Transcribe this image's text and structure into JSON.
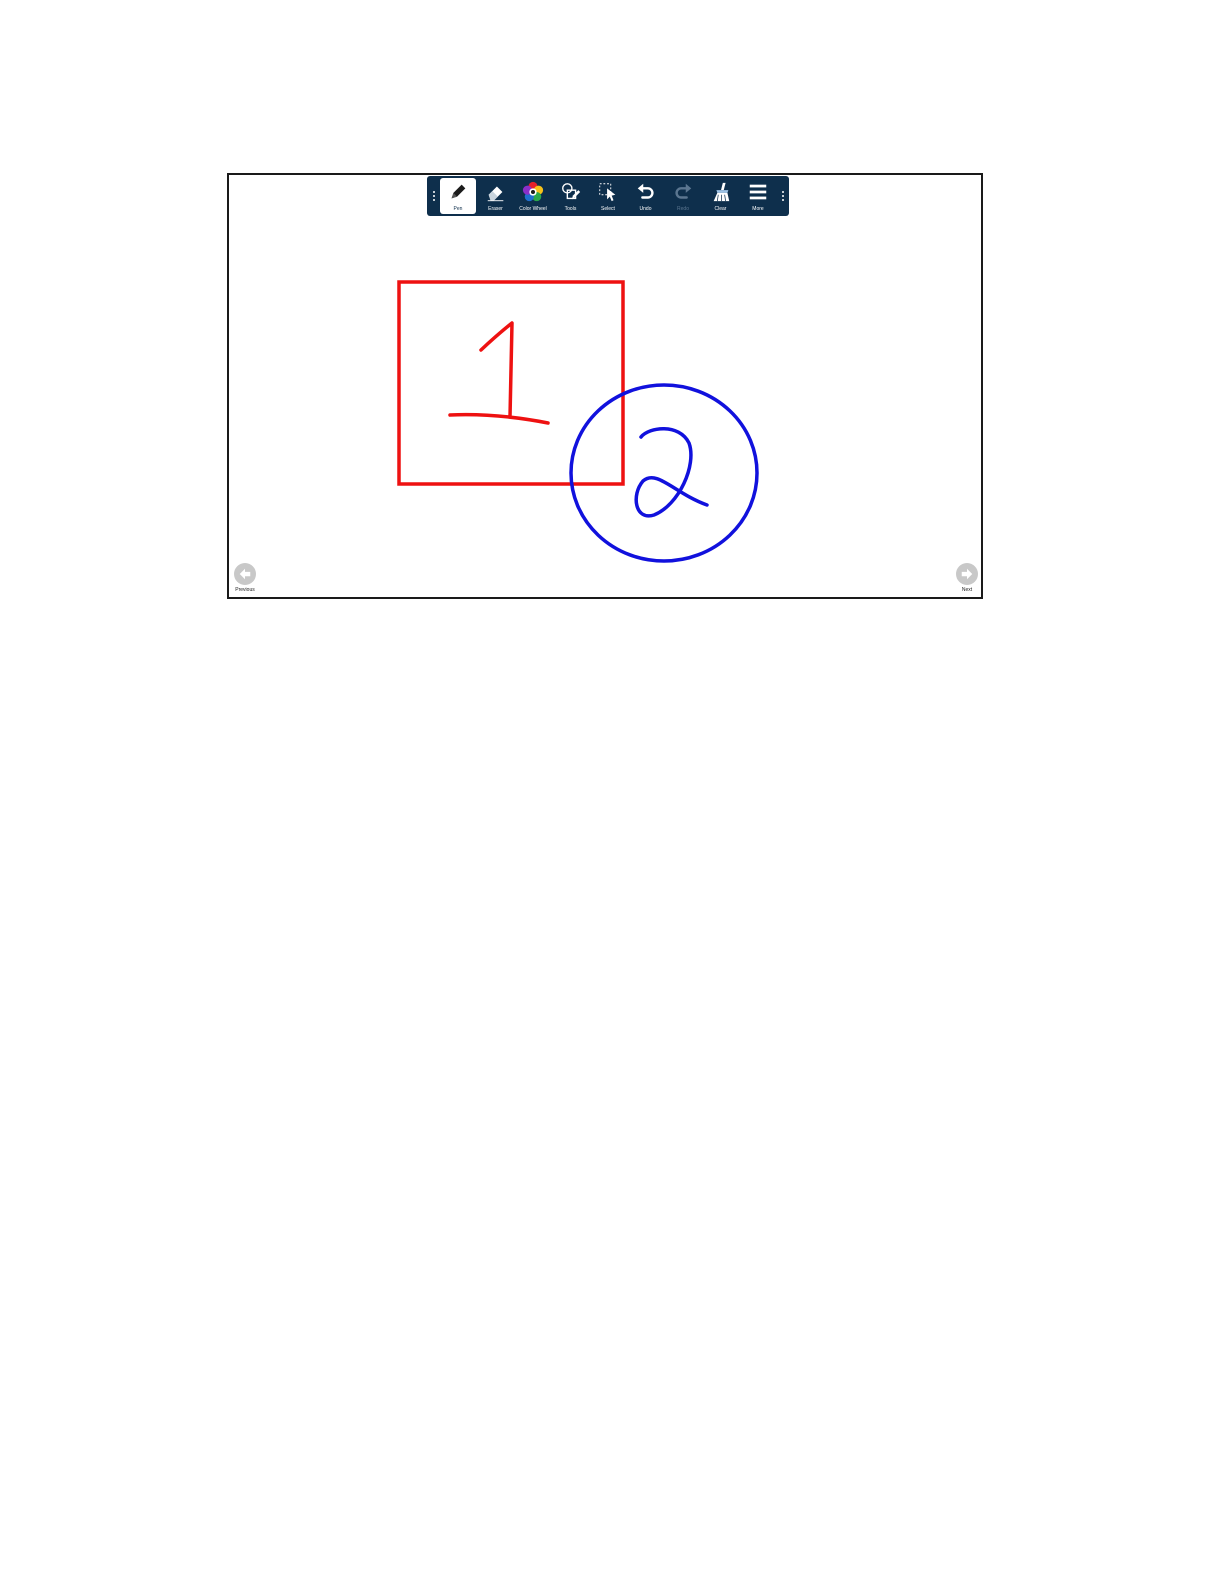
{
  "toolbar": {
    "tools": [
      {
        "label": "Pen",
        "icon": "pen-icon",
        "active": true
      },
      {
        "label": "Eraser",
        "icon": "eraser-icon"
      },
      {
        "label": "Color Wheel",
        "icon": "color-wheel-icon"
      },
      {
        "label": "Tools",
        "icon": "shape-tools-icon"
      },
      {
        "label": "Select",
        "icon": "select-icon"
      },
      {
        "label": "Undo",
        "icon": "undo-icon"
      },
      {
        "label": "Redo",
        "icon": "redo-icon",
        "disabled": true
      },
      {
        "label": "Clear",
        "icon": "clear-broom-icon"
      },
      {
        "label": "More",
        "icon": "menu-icon"
      }
    ]
  },
  "canvas": {
    "strokes": [
      {
        "name": "red-square",
        "color": "#ee1111"
      },
      {
        "name": "red-number-one",
        "color": "#ee1111"
      },
      {
        "name": "blue-circle",
        "color": "#1111dd"
      },
      {
        "name": "blue-number-two",
        "color": "#1111dd"
      }
    ]
  },
  "nav": {
    "previous_label": "Previous",
    "next_label": "Next"
  },
  "colors": {
    "toolbar_bg": "#0e2f4c",
    "board_border": "#1a1a1a",
    "nav_button": "#c8c8c8"
  }
}
